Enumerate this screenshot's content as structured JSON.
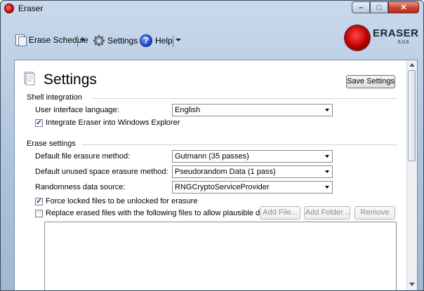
{
  "window": {
    "title": "Eraser"
  },
  "toolbar": {
    "erase_schedule": "Erase Schedule",
    "settings": "Settings",
    "help": "Help"
  },
  "brand": {
    "name": "ERASER",
    "version": "6.0.6"
  },
  "page": {
    "title": "Settings",
    "save_button": "Save Settings"
  },
  "shell_integration": {
    "heading": "Shell integration",
    "language_label": "User interface language:",
    "language_value": "English",
    "integrate_label": "Integrate Eraser into Windows Explorer",
    "integrate_checked": true
  },
  "erase_settings": {
    "heading": "Erase settings",
    "file_method_label": "Default file erasure method:",
    "file_method_value": "Gutmann (35 passes)",
    "unused_method_label": "Default unused space erasure method:",
    "unused_method_value": "Pseudorandom Data (1 pass)",
    "random_source_label": "Randomness data source:",
    "random_source_value": "RNGCryptoServiceProvider",
    "force_unlock_label": "Force locked files to be unlocked for erasure",
    "force_unlock_checked": true,
    "replace_label": "Replace erased files with the following files to allow plausible deniability",
    "replace_checked": false,
    "add_file": "Add File...",
    "add_folder": "Add Folder...",
    "remove": "Remove"
  }
}
